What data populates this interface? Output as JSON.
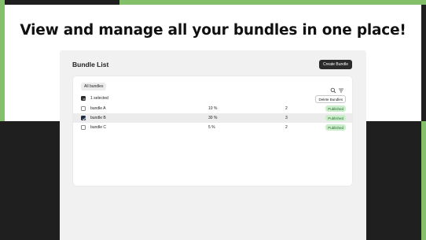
{
  "headline": "View and manage all your bundles in one place!",
  "panel": {
    "title": "Bundle List",
    "create_label": "Create Bundle"
  },
  "filters": {
    "tab_all": "All bundles",
    "search_icon": "search-icon",
    "filter_icon": "filter-sort-icon"
  },
  "selection": {
    "label": "1 selected",
    "delete_label": "Delete Bundles"
  },
  "bundles": [
    {
      "name": "bundle A",
      "percent": "10 %",
      "count": "2",
      "status": "Published",
      "checked": false
    },
    {
      "name": "bundle B",
      "percent": "30 %",
      "count": "3",
      "status": "Published",
      "checked": true
    },
    {
      "name": "bundle C",
      "percent": "5 %",
      "count": "2",
      "status": "Published",
      "checked": false
    }
  ],
  "colors": {
    "accent_green": "#84c069",
    "dark": "#1f1f1f",
    "badge_bg": "#cdeecd",
    "badge_text": "#1f6b2a"
  }
}
